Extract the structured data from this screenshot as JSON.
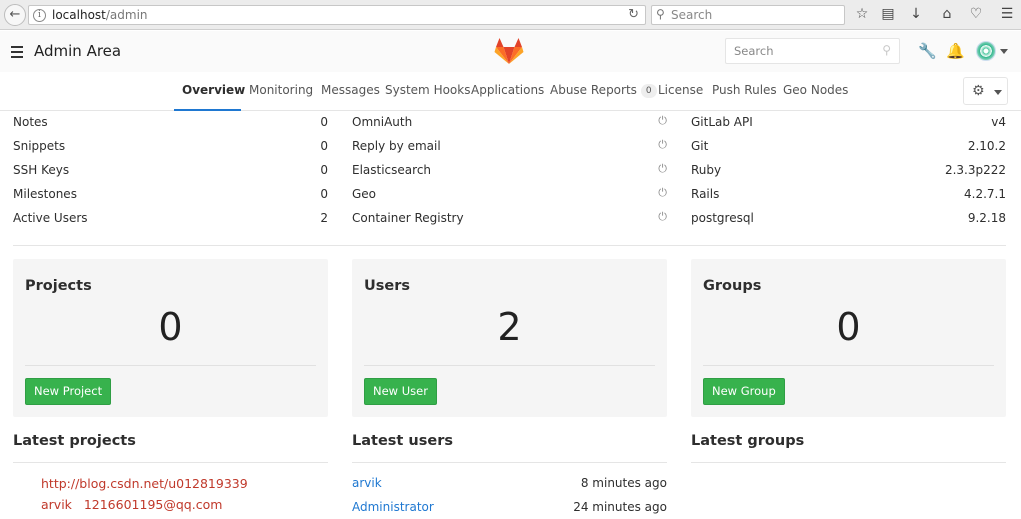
{
  "browser": {
    "url_host": "localhost",
    "url_path": "/admin",
    "search_placeholder": "Search"
  },
  "header": {
    "title": "Admin Area",
    "search_placeholder": "Search",
    "brand_color": "#e24329"
  },
  "tabs": [
    {
      "label": "Overview",
      "active": true
    },
    {
      "label": "Monitoring"
    },
    {
      "label": "Messages"
    },
    {
      "label": "System Hooks"
    },
    {
      "label": "Applications"
    },
    {
      "label": "Abuse Reports",
      "badge": "0"
    },
    {
      "label": "License"
    },
    {
      "label": "Push Rules"
    },
    {
      "label": "Geo Nodes"
    }
  ],
  "stats": [
    {
      "label": "Notes",
      "value": "0"
    },
    {
      "label": "Snippets",
      "value": "0"
    },
    {
      "label": "SSH Keys",
      "value": "0"
    },
    {
      "label": "Milestones",
      "value": "0"
    },
    {
      "label": "Active Users",
      "value": "2"
    }
  ],
  "features": [
    {
      "label": "OmniAuth"
    },
    {
      "label": "Reply by email"
    },
    {
      "label": "Elasticsearch"
    },
    {
      "label": "Geo"
    },
    {
      "label": "Container Registry"
    }
  ],
  "components": [
    {
      "label": "GitLab API",
      "value": "v4"
    },
    {
      "label": "Git",
      "value": "2.10.2"
    },
    {
      "label": "Ruby",
      "value": "2.3.3p222"
    },
    {
      "label": "Rails",
      "value": "4.2.7.1"
    },
    {
      "label": "postgresql",
      "value": "9.2.18"
    }
  ],
  "cards": [
    {
      "title": "Projects",
      "count": "0",
      "button": "New Project"
    },
    {
      "title": "Users",
      "count": "2",
      "button": "New User"
    },
    {
      "title": "Groups",
      "count": "0",
      "button": "New Group"
    }
  ],
  "latest": {
    "projects_title": "Latest projects",
    "users_title": "Latest users",
    "groups_title": "Latest groups",
    "project_links": [
      "http://blog.csdn.net/u012819339",
      "arvik   1216601195@qq.com"
    ],
    "users": [
      {
        "name": "arvik",
        "time": "8 minutes ago"
      },
      {
        "name": "Administrator",
        "time": "24 minutes ago"
      }
    ]
  },
  "colors": {
    "accent": "#1f78d1",
    "success": "#37b24d",
    "watermark": "#c0392b"
  }
}
